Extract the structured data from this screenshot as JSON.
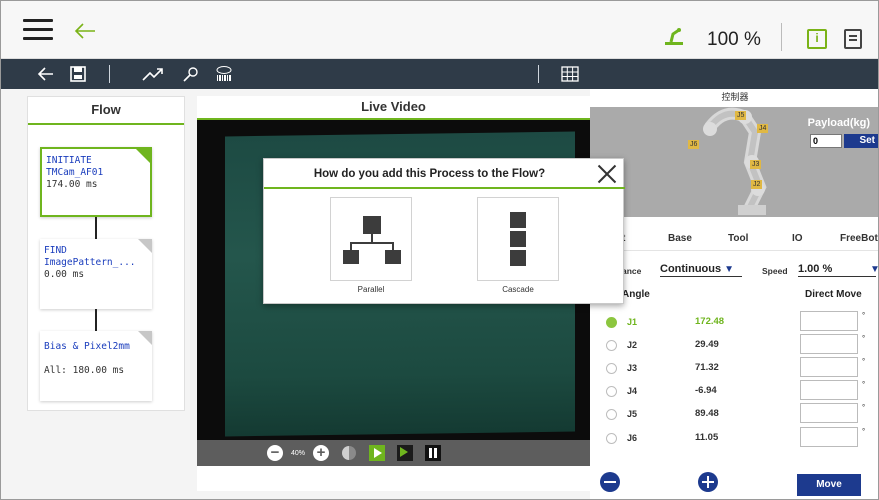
{
  "topbar": {
    "speed_percent": "100 %",
    "colors": {
      "accent": "#6fb51e",
      "primary": "#1d3a8e",
      "toolbar": "#2f3b48"
    }
  },
  "toolbar": {
    "icons": [
      "back-arrow-icon",
      "save-icon",
      "trend-icon",
      "find-icon",
      "barcode-icon",
      "grid-icon"
    ]
  },
  "flow": {
    "title": "Flow",
    "nodes": [
      {
        "name_lines": [
          "INITIATE",
          "TMCam_AF01"
        ],
        "time": "174.00 ms",
        "active": true
      },
      {
        "name_lines": [
          "FIND",
          "ImagePattern_..."
        ],
        "time": "0.00 ms",
        "active": false
      },
      {
        "name_lines": [
          "Bias & Pixel2mm"
        ],
        "time": "All: 180.00 ms",
        "active": false
      }
    ]
  },
  "live_video": {
    "title": "Live Video",
    "zoom": "40%"
  },
  "dialog": {
    "title": "How do you add this Process to the Flow?",
    "options": [
      {
        "label": "Parallel"
      },
      {
        "label": "Cascade"
      }
    ]
  },
  "controller": {
    "title": "控制器",
    "payload_label": "Payload(kg)",
    "payload_value": "0",
    "set_label": "Set",
    "joint_tags": [
      "J1",
      "J2",
      "J3",
      "J4",
      "J5",
      "J6"
    ],
    "tabs": [
      "t",
      "Base",
      "Tool",
      "IO",
      "FreeBot"
    ],
    "distance_label": "ance",
    "distance_value": "Continuous",
    "speed_label": "Speed",
    "speed_value": "1.00 %",
    "angle_header": "Angle",
    "direct_move_header": "Direct Move",
    "joints": [
      {
        "name": "J1",
        "value": "172.48",
        "selected": true
      },
      {
        "name": "J2",
        "value": "29.49",
        "selected": false
      },
      {
        "name": "J3",
        "value": "71.32",
        "selected": false
      },
      {
        "name": "J4",
        "value": "-6.94",
        "selected": false
      },
      {
        "name": "J5",
        "value": "89.48",
        "selected": false
      },
      {
        "name": "J6",
        "value": "11.05",
        "selected": false
      }
    ],
    "move_label": "Move"
  }
}
